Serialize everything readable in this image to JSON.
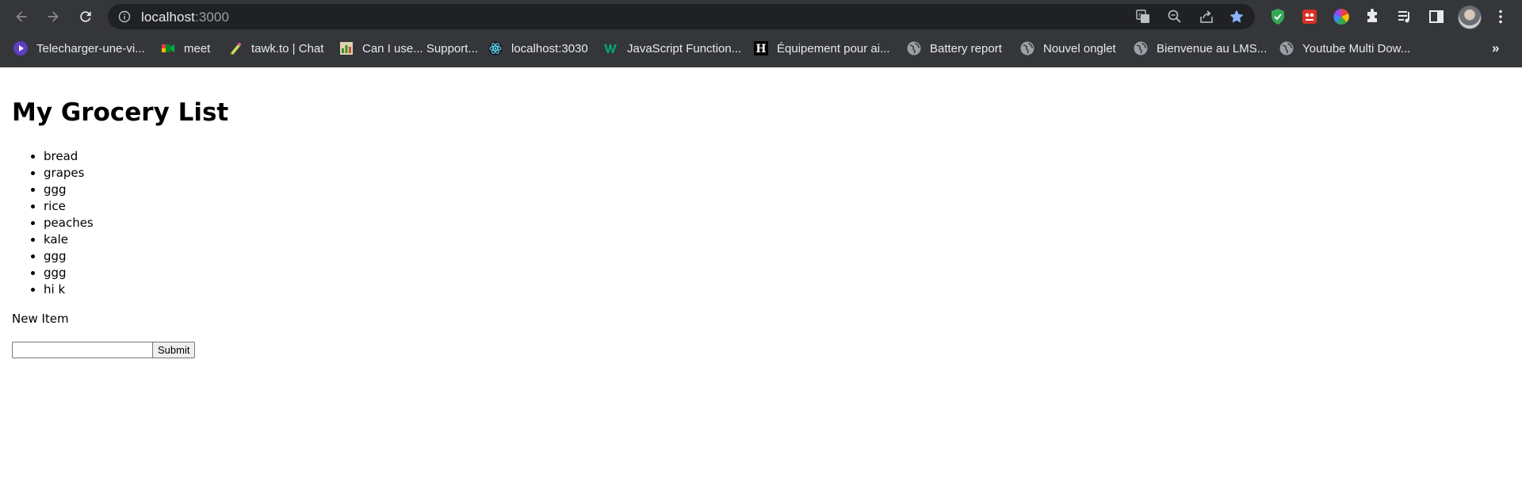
{
  "browser": {
    "url_host": "localhost",
    "url_port": ":3000",
    "bookmarks": [
      {
        "label": "Telecharger-une-vi...",
        "icon": "video-download-icon"
      },
      {
        "label": "meet",
        "icon": "google-meet-icon"
      },
      {
        "label": "tawk.to | Chat",
        "icon": "tawkto-icon"
      },
      {
        "label": "Can I use... Support...",
        "icon": "caniuse-icon"
      },
      {
        "label": "localhost:3030",
        "icon": "react-icon"
      },
      {
        "label": "JavaScript Function...",
        "icon": "w3-icon"
      },
      {
        "label": "Équipement pour ai...",
        "icon": "h-logo-icon"
      },
      {
        "label": "Battery report",
        "icon": "globe-icon"
      },
      {
        "label": "Nouvel onglet",
        "icon": "globe-icon"
      },
      {
        "label": "Bienvenue au LMS...",
        "icon": "globe-icon"
      },
      {
        "label": "Youtube Multi Dow...",
        "icon": "globe-icon"
      }
    ],
    "more_bookmarks": "»"
  },
  "page": {
    "title": "My Grocery List",
    "items": [
      "bread",
      "grapes",
      "ggg",
      "rice",
      "peaches",
      "kale",
      "ggg",
      "ggg",
      "hi k"
    ],
    "new_item_label": "New Item",
    "input_value": "",
    "submit_label": "Submit"
  },
  "colors": {
    "chrome_bg": "#35363a",
    "omnibox_bg": "#202124",
    "star_blue": "#8ab4f8"
  }
}
